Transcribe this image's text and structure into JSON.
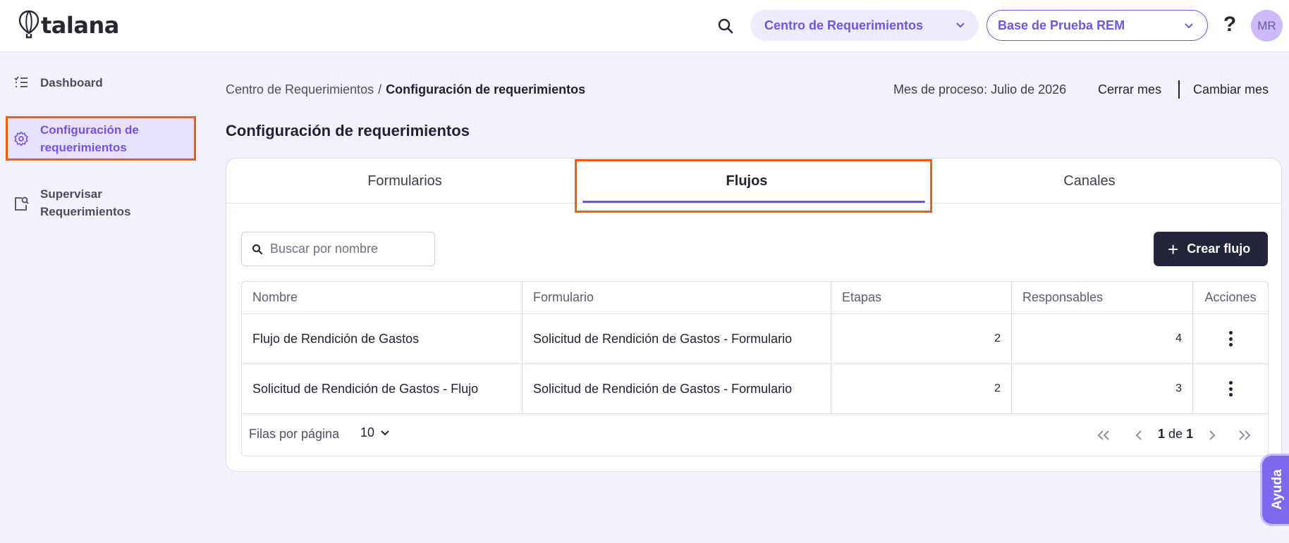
{
  "app": {
    "logo_text": "talana"
  },
  "header": {
    "centro_select": "Centro de Requerimientos",
    "base_select": "Base de Prueba REM",
    "help_label": "?",
    "avatar_initials": "MR"
  },
  "sidebar": {
    "items": [
      {
        "label": "Dashboard",
        "icon": "list-check-icon"
      },
      {
        "label_line1": "Configuración de",
        "label_line2": "requerimientos",
        "icon": "gear-icon",
        "active": true
      },
      {
        "label_line1": "Supervisar",
        "label_line2": "Requerimientos",
        "icon": "document-search-icon"
      }
    ]
  },
  "breadcrumb": {
    "parent": "Centro de Requerimientos",
    "separator": "/",
    "current": "Configuración de requerimientos"
  },
  "process": {
    "month_text": "Mes de proceso: Julio de 2026",
    "close_label": "Cerrar mes",
    "change_label": "Cambiar mes"
  },
  "page_title": "Configuración de requerimientos",
  "tabs": [
    {
      "label": "Formularios"
    },
    {
      "label": "Flujos",
      "active": true
    },
    {
      "label": "Canales"
    }
  ],
  "search": {
    "placeholder": "Buscar por nombre",
    "value": ""
  },
  "create_button": {
    "label": "Crear flujo"
  },
  "table": {
    "headers": {
      "nombre": "Nombre",
      "formulario": "Formulario",
      "etapas": "Etapas",
      "responsables": "Responsables",
      "acciones": "Acciones"
    },
    "rows": [
      {
        "nombre": "Flujo de Rendición de Gastos",
        "formulario": "Solicitud de Rendición de Gastos - Formulario",
        "etapas": "2",
        "responsables": "4"
      },
      {
        "nombre": "Solicitud de Rendición de Gastos - Flujo",
        "formulario": "Solicitud de Rendición de Gastos - Formulario",
        "etapas": "2",
        "responsables": "3"
      }
    ]
  },
  "pagination": {
    "rows_per_page_label": "Filas por página",
    "rows_per_page_value": "10",
    "current_page": "1",
    "of_label": "de",
    "total_pages": "1"
  },
  "help_tab": {
    "label": "Ayuda"
  },
  "colors": {
    "accent": "#7154e6",
    "highlight": "#ff5a00",
    "dark_button": "#24243a",
    "background": "#f3f1fd"
  }
}
